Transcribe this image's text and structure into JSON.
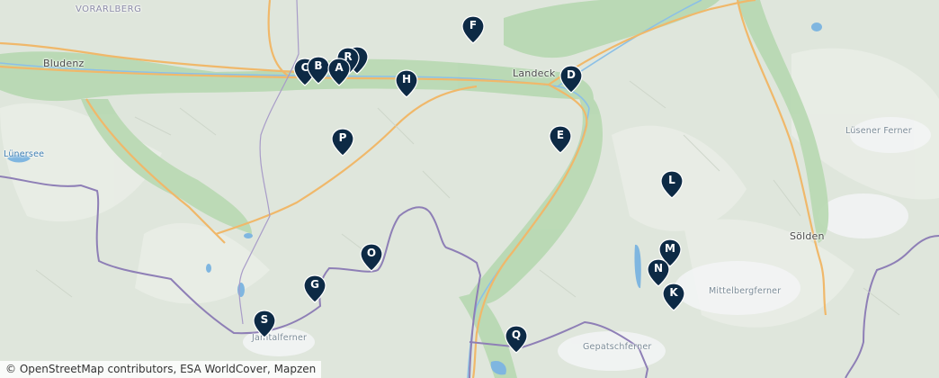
{
  "map": {
    "attribution": "© OpenStreetMap contributors, ESA WorldCover, Mapzen",
    "colors": {
      "land": "#dfe6dc",
      "valley": "#b9d9b3",
      "road": "#f0b86a",
      "border": "#8e7fb6",
      "water": "#7fb6e0",
      "marker": "#0d2a45"
    },
    "places": [
      {
        "id": "vorarlberg",
        "name": "VORARLBERG",
        "kind": "region"
      },
      {
        "id": "bludenz",
        "name": "Bludenz",
        "kind": "town"
      },
      {
        "id": "landeck",
        "name": "Landeck",
        "kind": "town"
      },
      {
        "id": "lunersee",
        "name": "Lünersee",
        "kind": "water"
      },
      {
        "id": "lusener-ferner",
        "name": "Lüsener Ferner",
        "kind": "glacier"
      },
      {
        "id": "solden",
        "name": "Sölden",
        "kind": "town"
      },
      {
        "id": "mittelbergferner",
        "name": "Mittelbergferner",
        "kind": "glacier"
      },
      {
        "id": "gepatschferner",
        "name": "Gepatschferner",
        "kind": "glacier"
      },
      {
        "id": "jamtalferner",
        "name": "Jamtalferner",
        "kind": "glacier"
      }
    ],
    "markers": [
      "A",
      "B",
      "C",
      "D",
      "E",
      "F",
      "G",
      "H",
      "K",
      "L",
      "M",
      "N",
      "O",
      "P",
      "Q",
      "R",
      "S"
    ]
  }
}
